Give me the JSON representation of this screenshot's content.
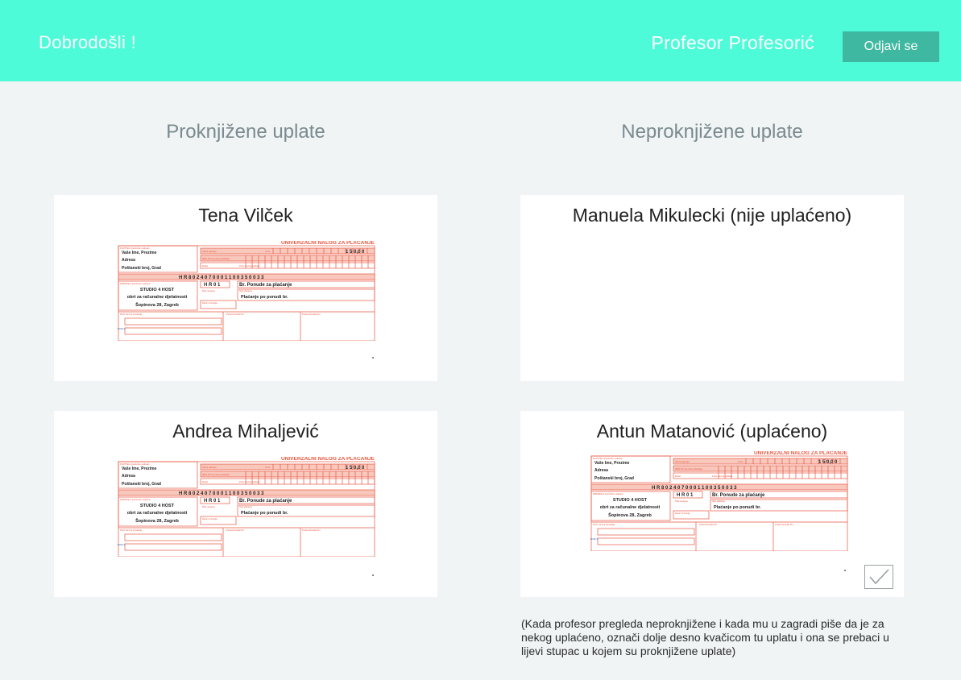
{
  "header": {
    "welcome": "Dobrodošli !",
    "user_name": "Profesor Profesorić",
    "logout_label": "Odjavi se",
    "bg_color": "#4efbd8",
    "button_color": "#3eb8a0"
  },
  "columns": {
    "booked_title": "Proknjižene uplate",
    "unbooked_title": "Neproknjižene uplate"
  },
  "booked": [
    {
      "name": "Tena Vilček"
    },
    {
      "name": "Andrea Mihaljević"
    }
  ],
  "unbooked": [
    {
      "name": "Manuela Mikulecki (nije uplaćeno)"
    },
    {
      "name": "Antun Matanović (uplaćeno)"
    }
  ],
  "slip": {
    "header": "UNIVERZALNI NALOG ZA PLAĆANJE",
    "payer_label": "PLATITELJ (naziv/ime i adresa)",
    "payer_line1": "Vaše Ime, Prezime",
    "payer_line2": "Adresa",
    "payer_line3": "Poštanski broj, Grad",
    "recipient_label": "PRIMATELJ (naziv/ime i adresa)",
    "recipient_line1": "STUDIO 4 HOST",
    "recipient_line2": "obrt za računalne djelatnosti",
    "recipient_line3": "Šopinova 28, Zagreb",
    "amount": "1 5 0,0 0",
    "iban": "H R 8 0 2 4 0 7 0 0 0 1 1 0 0 3 5 0 0 3 3",
    "model": "H R 0 1",
    "reference": "Br. Ponude za plaćanje",
    "description": "Plaćanje po ponudi br.",
    "currency_label": "Valuta plaćanja",
    "amount_label": "Iznos",
    "iban_label": "IBAN i/ili broj računa platitelja",
    "model_label": "Model",
    "ref_label": "Poziv na broj primatelja",
    "desc_label": "Opis plaćanja",
    "date_label": "Datum izvršenja",
    "sig_label": "Potpis korisnika PU",
    "stamp_label": "Pečat korisnika PU",
    "code_label": "Šifra namjene",
    "ref_payer_label": "Poziv na broj platitelja",
    "side_text": "HUB-3",
    "line_color": "#e8553f",
    "fill_color": "#f8c8bd"
  },
  "note": "(Kada profesor pregleda neproknjižene i kada mu u zagradi piše da je za nekog uplaćeno, označi dolje desno kvačicom tu uplatu i ona se prebaci u lijevi stupac u kojem su proknjižene uplate)"
}
